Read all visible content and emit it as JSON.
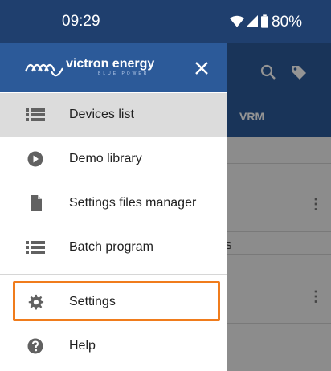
{
  "status_bar": {
    "time": "09:29",
    "battery": "80%"
  },
  "background_app": {
    "tab_label": "VRM",
    "row_fragment": "S"
  },
  "drawer": {
    "brand": "victron energy",
    "brand_sub": "BLUE POWER",
    "items": [
      {
        "label": "Devices list",
        "icon": "list-icon"
      },
      {
        "label": "Demo library",
        "icon": "play-circle-icon"
      },
      {
        "label": "Settings files manager",
        "icon": "file-icon"
      },
      {
        "label": "Batch program",
        "icon": "list-icon"
      },
      {
        "label": "Settings",
        "icon": "gear-icon"
      },
      {
        "label": "Help",
        "icon": "help-circle-icon"
      }
    ]
  },
  "colors": {
    "primary": "#2c5a99",
    "status_bar": "#1f3f6e",
    "highlight": "#f07c1c"
  }
}
